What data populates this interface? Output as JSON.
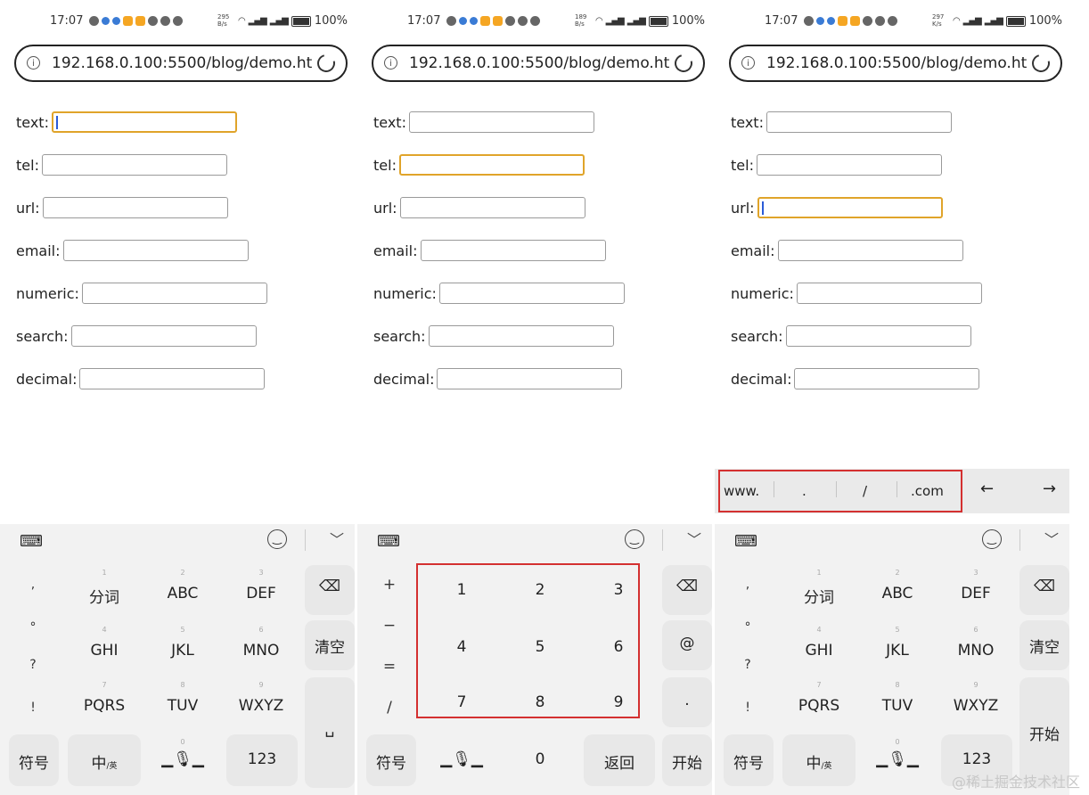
{
  "status": {
    "time": "17:07",
    "battery": "100%",
    "speeds": [
      "295\nB/s",
      "189\nB/s",
      "297\nK/s"
    ]
  },
  "browser": {
    "url": "192.168.0.100:5500/blog/demo.ht"
  },
  "form_fields": [
    {
      "label": "text:"
    },
    {
      "label": "tel:"
    },
    {
      "label": "url:"
    },
    {
      "label": "email:"
    },
    {
      "label": "numeric:"
    },
    {
      "label": "search:"
    },
    {
      "label": "decimal:"
    }
  ],
  "focused_field_per_screen": [
    "text",
    "tel",
    "url"
  ],
  "t9_keyboard": {
    "punct": [
      ",",
      "°",
      "?",
      "!"
    ],
    "rows": [
      [
        {
          "num": "1",
          "label": "分词"
        },
        {
          "num": "2",
          "label": "ABC"
        },
        {
          "num": "3",
          "label": "DEF"
        }
      ],
      [
        {
          "num": "4",
          "label": "GHI"
        },
        {
          "num": "5",
          "label": "JKL"
        },
        {
          "num": "6",
          "label": "MNO"
        }
      ],
      [
        {
          "num": "7",
          "label": "PQRS"
        },
        {
          "num": "8",
          "label": "TUV"
        },
        {
          "num": "9",
          "label": "WXYZ"
        }
      ]
    ],
    "clear_label": "清空",
    "start_label": "开始",
    "symbols_label": "符号",
    "chinese_label": "中",
    "chinese_sub": "/英",
    "zero_sub": "0",
    "num_label": "123"
  },
  "num_keyboard": {
    "left_col": [
      "+",
      "−",
      "=",
      "/"
    ],
    "digits": [
      "1",
      "2",
      "3",
      "4",
      "5",
      "6",
      "7",
      "8",
      "9"
    ],
    "right_col": [
      "@",
      "."
    ],
    "symbols_label": "符号",
    "zero_label": "0",
    "back_label": "返回",
    "start_label": "开始"
  },
  "url_suggestions": [
    "www.",
    ".",
    "/",
    ".com"
  ],
  "watermark": "@稀土掘金技术社区",
  "colors": {
    "focus": "#e0a42a",
    "caret": "#2a5bd7",
    "highlight_box": "#d43030",
    "keyboard_bg": "#f2f2f2"
  }
}
